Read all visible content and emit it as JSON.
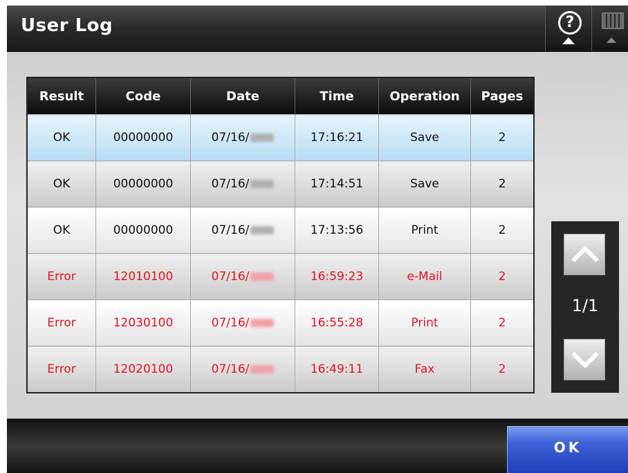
{
  "window": {
    "title": "User Log"
  },
  "header": {
    "help_icon": "question-mark-circle-icon",
    "help_glyph": "?",
    "keyboard_icon": "keyboard-icon"
  },
  "table": {
    "columns": [
      "Result",
      "Code",
      "Date",
      "Time",
      "Operation",
      "Pages"
    ],
    "rows": [
      {
        "result": "OK",
        "code": "00000000",
        "date": "07/16/",
        "time": "17:16:21",
        "operation": "Save",
        "pages": "2",
        "status": "ok",
        "selected": true
      },
      {
        "result": "OK",
        "code": "00000000",
        "date": "07/16/",
        "time": "17:14:51",
        "operation": "Save",
        "pages": "2",
        "status": "ok",
        "selected": false
      },
      {
        "result": "OK",
        "code": "00000000",
        "date": "07/16/",
        "time": "17:13:56",
        "operation": "Print",
        "pages": "2",
        "status": "ok",
        "selected": false
      },
      {
        "result": "Error",
        "code": "12010100",
        "date": "07/16/",
        "time": "16:59:23",
        "operation": "e-Mail",
        "pages": "2",
        "status": "error",
        "selected": false
      },
      {
        "result": "Error",
        "code": "12030100",
        "date": "07/16/",
        "time": "16:55:28",
        "operation": "Print",
        "pages": "2",
        "status": "error",
        "selected": false
      },
      {
        "result": "Error",
        "code": "12020100",
        "date": "07/16/",
        "time": "16:49:11",
        "operation": "Fax",
        "pages": "2",
        "status": "error",
        "selected": false
      }
    ]
  },
  "pager": {
    "page_indicator": "1/1",
    "up_icon": "chevron-up-icon",
    "down_icon": "chevron-down-icon"
  },
  "footer": {
    "ok_label": "OK"
  },
  "colors": {
    "error_text": "#e0141e",
    "selected_row": "#c6e4f6",
    "ok_button": "#2f52cc"
  }
}
